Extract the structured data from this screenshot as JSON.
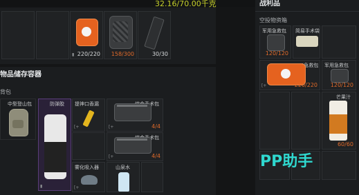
{
  "header": {
    "weight": "32.16/70.00千克"
  },
  "equip": {
    "row": [
      {
        "qty": "220/220"
      },
      {
        "qty": "158/300"
      },
      {
        "qty": "30/30"
      }
    ]
  },
  "storage": {
    "title": "物品储存容器",
    "subtitle": "背包",
    "backpack_label": "中型登山包",
    "items": [
      {
        "name": "防弹胶"
      },
      {
        "name": "提神口香漏"
      },
      {
        "name": "综合手术包",
        "qty": "4/4"
      },
      {
        "name": "综合手术包",
        "qty": "4/4"
      },
      {
        "name": "雾化吸入器"
      },
      {
        "name": "山泉水"
      }
    ]
  },
  "loot": {
    "title": "战利品",
    "subtitle": "空投物资箱",
    "items": [
      {
        "name": "军用急救包",
        "qty": "120/120"
      },
      {
        "name": "简易手术袋"
      },
      {
        "name": "936急救包",
        "qty": "220/220"
      },
      {
        "name": "军用急救包",
        "qty": "120/120"
      },
      {
        "name": "芒果汁",
        "qty": "60/60"
      }
    ]
  },
  "watermark": "PP助手",
  "colors": {
    "accent": "#e06a2a",
    "weight": "#c6d02a",
    "watermark": "#2fd8cf"
  }
}
